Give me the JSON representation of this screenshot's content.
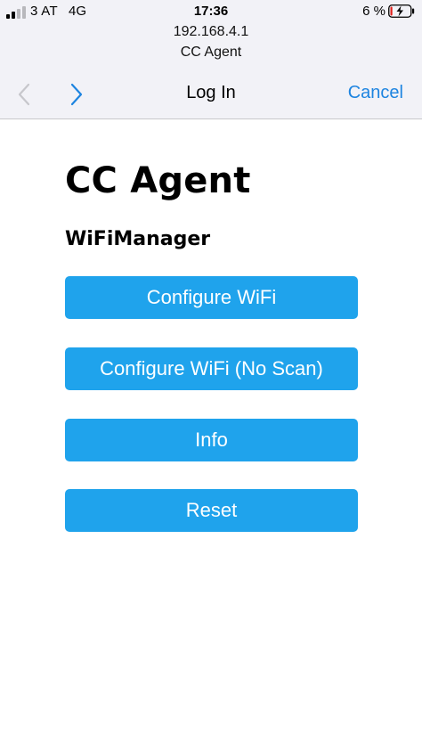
{
  "status_bar": {
    "carrier": "3 AT",
    "network": "4G",
    "time": "17:36",
    "battery_percent": "6 %"
  },
  "browser": {
    "url": "192.168.4.1",
    "site_name": "CC Agent",
    "nav_title": "Log In",
    "cancel_label": "Cancel",
    "accent_color": "#1d84e0"
  },
  "page": {
    "title": "CC Agent",
    "subtitle": "WiFiManager",
    "button_color": "#1fa3ec",
    "buttons": [
      {
        "label": "Configure WiFi"
      },
      {
        "label": "Configure WiFi (No Scan)"
      },
      {
        "label": "Info"
      },
      {
        "label": "Reset"
      }
    ]
  },
  "icons": {
    "signal": "signal-strength-icon",
    "battery": "battery-charging-icon",
    "back": "chevron-left-icon",
    "forward": "chevron-right-icon"
  }
}
